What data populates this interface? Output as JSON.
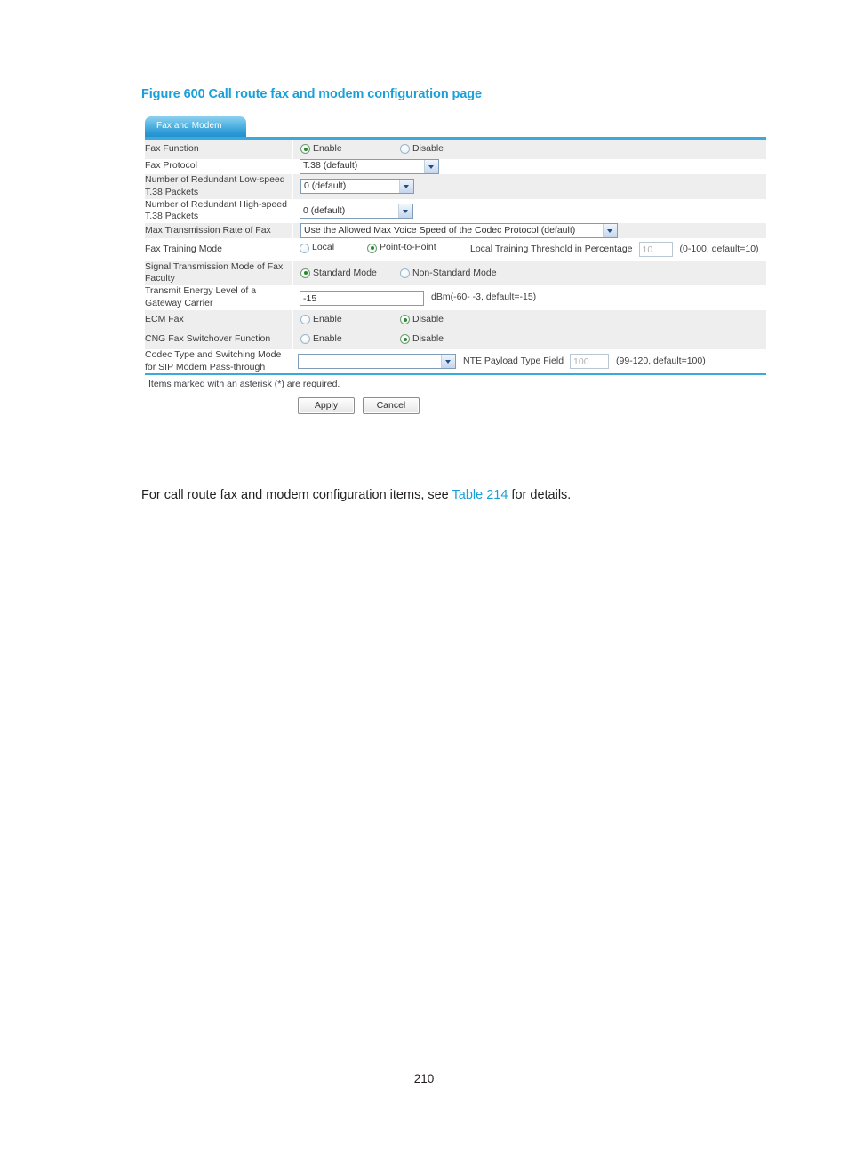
{
  "figure": {
    "caption": "Figure 600 Call route fax and modem configuration page"
  },
  "panel": {
    "tab_label": "Fax and Modem",
    "accent_color": "#3aa9de",
    "rows": [
      {
        "label": "Fax Function",
        "type": "radio2",
        "options": [
          "Enable",
          "Disable"
        ],
        "selected": "Enable"
      },
      {
        "label": "Fax Protocol",
        "type": "select",
        "value": "T.38 (default)"
      },
      {
        "label": "Number of Redundant Low-speed T.38 Packets",
        "type": "select",
        "value": "0 (default)"
      },
      {
        "label": "Number of Redundant High-speed T.38 Packets",
        "type": "select",
        "value": "0 (default)"
      },
      {
        "label": "Max Transmission Rate of Fax",
        "type": "select",
        "value": "Use the Allowed Max Voice Speed of the Codec Protocol (default)"
      },
      {
        "label": "Fax Training Mode",
        "type": "training",
        "options": [
          "Local",
          "Point-to-Point"
        ],
        "selected": "Point-to-Point",
        "threshold_label": "Local Training Threshold in Percentage",
        "threshold_value": "10",
        "threshold_hint": "(0-100, default=10)"
      },
      {
        "label": "Signal Transmission Mode of Fax Faculty",
        "type": "radio2",
        "options": [
          "Standard Mode",
          "Non-Standard Mode"
        ],
        "selected": "Standard Mode"
      },
      {
        "label": "Transmit Energy Level of a Gateway Carrier",
        "type": "text",
        "value": "-15",
        "hint": "dBm(-60- -3, default=-15)"
      },
      {
        "label": "ECM Fax",
        "type": "radio2",
        "options": [
          "Enable",
          "Disable"
        ],
        "selected": "Disable"
      },
      {
        "label": "CNG Fax Switchover Function",
        "type": "radio2",
        "options": [
          "Enable",
          "Disable"
        ],
        "selected": "Disable"
      },
      {
        "label": "Codec Type and Switching Mode for SIP Modem Pass-through",
        "type": "codec",
        "value": "",
        "nte_label": "NTE Payload Type Field",
        "nte_value": "100",
        "nte_hint": "(99-120, default=100)"
      }
    ],
    "required_note": "Items marked with an asterisk (*) are required.",
    "apply_label": "Apply",
    "cancel_label": "Cancel"
  },
  "body": {
    "para_before": "For call route fax and modem configuration items, see ",
    "para_link": "Table 214",
    "para_after": " for details."
  },
  "footer": {
    "page_number": "210"
  }
}
